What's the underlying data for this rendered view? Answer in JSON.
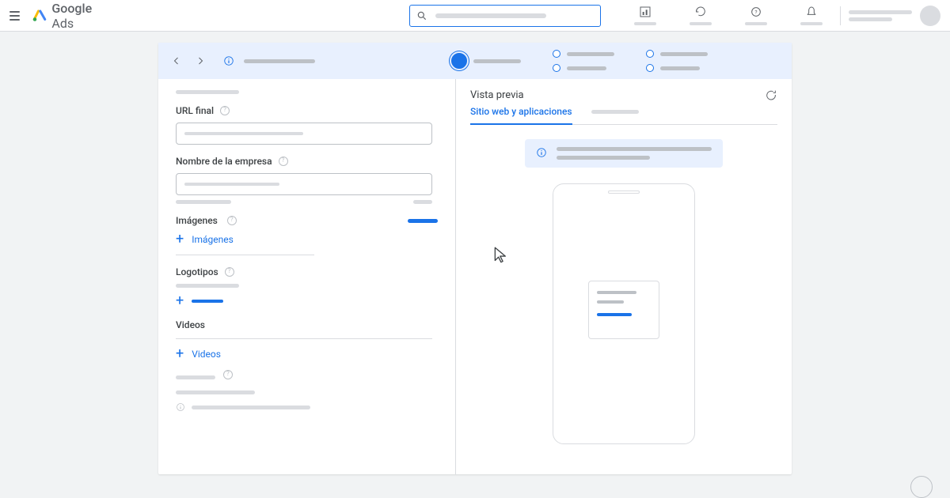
{
  "topbar": {
    "brand_name": "Google",
    "brand_suffix": "Ads"
  },
  "form": {
    "url_label": "URL final",
    "company_label": "Nombre de la empresa",
    "images_label": "Imágenes",
    "add_images": "Imágenes",
    "logos_label": "Logotipos",
    "videos_label": "Videos",
    "add_videos": "Videos"
  },
  "preview": {
    "title": "Vista previa",
    "tab_active": "Sitio web y aplicaciones"
  }
}
